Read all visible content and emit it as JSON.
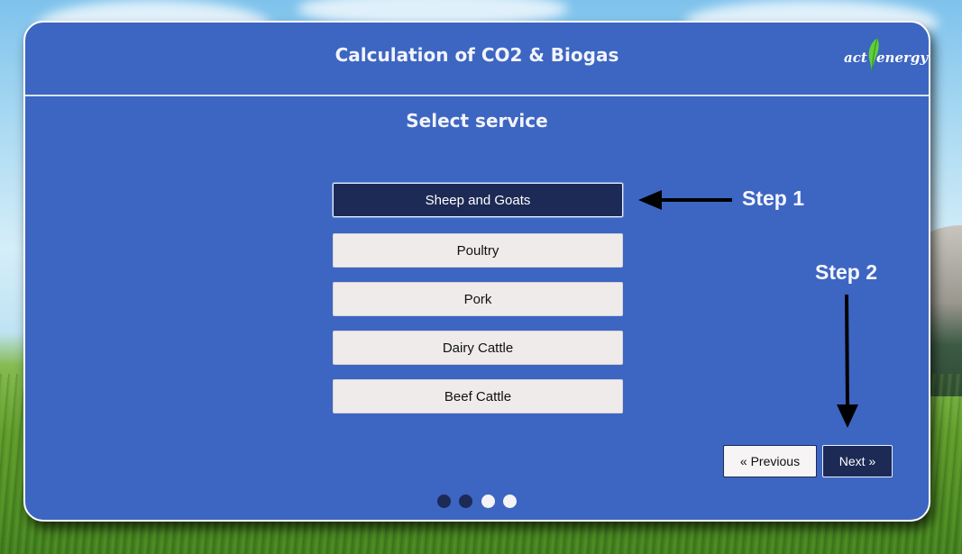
{
  "app": {
    "title": "Calculation of CO2 & Biogas",
    "logo_text_left": "act",
    "logo_text_right": "energy"
  },
  "section_title": "Select service",
  "services": [
    {
      "label": "Sheep and Goats",
      "selected": true
    },
    {
      "label": "Poultry",
      "selected": false
    },
    {
      "label": "Pork",
      "selected": false
    },
    {
      "label": "Dairy Cattle",
      "selected": false
    },
    {
      "label": "Beef Cattle",
      "selected": false
    }
  ],
  "annotations": {
    "step1": "Step 1",
    "step2": "Step 2"
  },
  "nav": {
    "previous_label": "« Previous",
    "next_label": "Next »"
  },
  "progress": {
    "total_steps": 4,
    "completed_steps": 2
  },
  "colors": {
    "panel": "#3d65c2",
    "accent_dark": "#1c2a55",
    "button_light": "#efebeb",
    "leaf_green": "#5fcf3a"
  }
}
